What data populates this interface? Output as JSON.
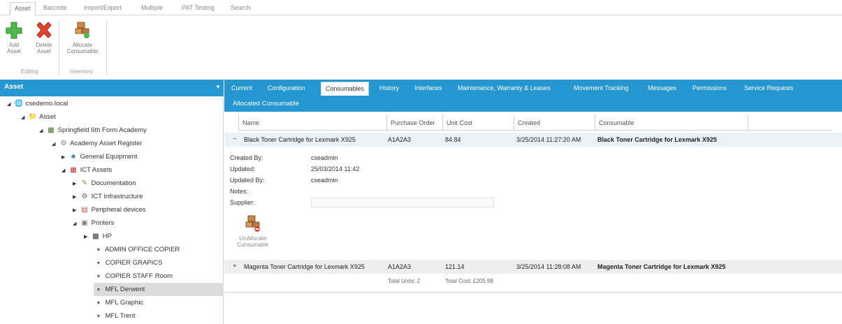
{
  "ribbon": {
    "tabs": [
      "Asset",
      "Barcode",
      "Import/Export",
      "Multiple",
      "PAT Testing",
      "Search"
    ],
    "buttons": {
      "add_asset": "Add Asset",
      "delete_asset": "Delete Asset",
      "allocate_consumable": "Allocate Consumable"
    },
    "groups": {
      "editing": "Editing",
      "inventory": "Inventory"
    }
  },
  "left_panel": {
    "title": "Asset",
    "tree": [
      {
        "label": "csedemo.local",
        "toggle": "◢",
        "icon": "🌐"
      },
      {
        "label": "Asset",
        "toggle": "◢",
        "icon": "📁"
      },
      {
        "label": "Springfield 6th Form Academy",
        "toggle": "◢",
        "icon": "▦"
      },
      {
        "label": "Academy Asset Register",
        "toggle": "◢",
        "icon": "⚙"
      },
      {
        "label": "General Equipment",
        "toggle": "▶",
        "icon": "♣"
      },
      {
        "label": "ICT Assets",
        "toggle": "◢",
        "icon": "▦"
      },
      {
        "label": "Documentation",
        "toggle": "▶",
        "icon": "✎"
      },
      {
        "label": "ICT Infrastructure",
        "toggle": "▶",
        "icon": "⚙"
      },
      {
        "label": "Peripheral devices",
        "toggle": "▶",
        "icon": "▤"
      },
      {
        "label": "Printers",
        "toggle": "◢",
        "icon": "▣"
      },
      {
        "label": "HP",
        "toggle": "▶",
        "icon": "▩"
      },
      {
        "label": "ADMIN OFFICE COPIER",
        "toggle": "",
        "icon": "▼"
      },
      {
        "label": "COPIER GRAPICS",
        "toggle": "",
        "icon": "▼"
      },
      {
        "label": "COPIER STAFF Room",
        "toggle": "",
        "icon": "▼"
      },
      {
        "label": "MFL Derwent",
        "toggle": "",
        "icon": "▼"
      },
      {
        "label": "MFL Graphic",
        "toggle": "",
        "icon": "▼"
      },
      {
        "label": "MFL Trent",
        "toggle": "",
        "icon": "▼"
      }
    ]
  },
  "tabs": [
    "Current",
    "Configuration",
    "Consumables",
    "History",
    "Interfaces",
    "Maintenance, Warranty & Leases",
    "Movement Tracking",
    "Messages",
    "Permissions",
    "Service Requests"
  ],
  "section": {
    "title": "Allocated Consumable"
  },
  "grid": {
    "columns": [
      "Name",
      "Purchase Order",
      "Unit Cost",
      "Created",
      "Consumable"
    ],
    "rows": [
      {
        "expander": "−",
        "name": "Black Toner Cartridge for Lexmark X925",
        "purchase_order": "A1A2A3",
        "unit_cost": "84.84",
        "created": "3/25/2014 11:27:20 AM",
        "consumable": "Black Toner Cartridge for Lexmark X925"
      },
      {
        "expander": "+",
        "name": "Magenta Toner Cartridge for Lexmark X925",
        "purchase_order": "A1A2A3",
        "unit_cost": "121.14",
        "created": "3/25/2014 11:28:08 AM",
        "consumable": "Magenta Toner Cartridge for Lexmark X925"
      }
    ],
    "details": {
      "created_by_label": "Created By:",
      "created_by": "cseadmin",
      "updated_label": "Updated:",
      "updated": "25/03/2014 11:42",
      "updated_by_label": "Updated By:",
      "updated_by": "cseadmin",
      "notes_label": "Notes:",
      "supplier_label": "Supplier:",
      "unallocate_label": "UnAllocate Consumable"
    },
    "totals": {
      "units": "Total Units: 2",
      "cost": "Total Cost: £205.98"
    }
  },
  "colors": {
    "accent": "#2596cf",
    "selected_row": "#dcdcdc",
    "expanded_row": "#eaf1f7"
  }
}
